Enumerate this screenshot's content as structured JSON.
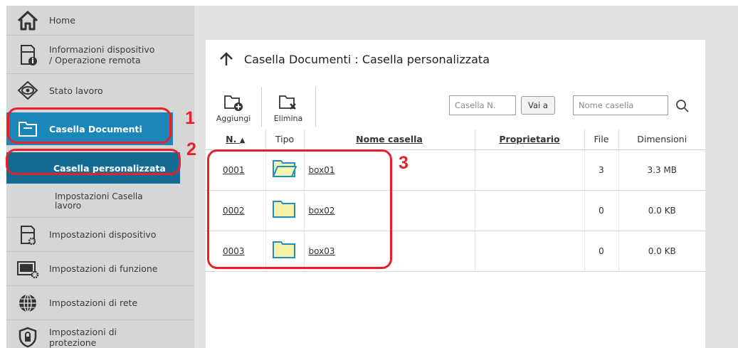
{
  "sidebar": {
    "items": [
      {
        "id": "home",
        "label": "Home"
      },
      {
        "id": "device-info",
        "label": "Informazioni dispositivo",
        "label2": "/ Operazione remota"
      },
      {
        "id": "job-status",
        "label": "Stato lavoro"
      },
      {
        "id": "document-box",
        "label": "Casella Documenti"
      },
      {
        "id": "device-settings",
        "label": "Impostazioni dispositivo"
      },
      {
        "id": "function-settings",
        "label": "Impostazioni di funzione"
      },
      {
        "id": "network-settings",
        "label": "Impostazioni di rete"
      },
      {
        "id": "security-settings",
        "label": "Impostazioni di",
        "label2": "protezione"
      }
    ],
    "subitems": [
      {
        "id": "custom-box",
        "label": "Casella personalizzata"
      },
      {
        "id": "job-box-settings",
        "label": "Impostazioni Casella",
        "label2": "lavoro"
      }
    ]
  },
  "callouts": [
    "1",
    "2",
    "3"
  ],
  "main": {
    "title": "Casella Documenti : Casella personalizzata",
    "toolbar": {
      "add_label": "Aggiungi",
      "delete_label": "Elimina",
      "box_number_placeholder": "Casella N.",
      "go_label": "Vai a",
      "box_name_placeholder": "Nome casella"
    },
    "table": {
      "headers": [
        "N.",
        "Tipo",
        "Nome casella",
        "Proprietario",
        "File",
        "Dimensioni"
      ],
      "rows": [
        {
          "number": "0001",
          "name": "box01",
          "owner": "",
          "files": "3",
          "size": "3.3 MB",
          "open": true
        },
        {
          "number": "0002",
          "name": "box02",
          "owner": "",
          "files": "0",
          "size": "0.0 KB",
          "open": false
        },
        {
          "number": "0003",
          "name": "box03",
          "owner": "",
          "files": "0",
          "size": "0.0 KB",
          "open": false
        }
      ]
    }
  },
  "colors": {
    "active_nav": "#1a87b8",
    "active_sub": "#146b93",
    "callout_red": "#e8202b",
    "folder_yellow": "#f6f1a8"
  }
}
